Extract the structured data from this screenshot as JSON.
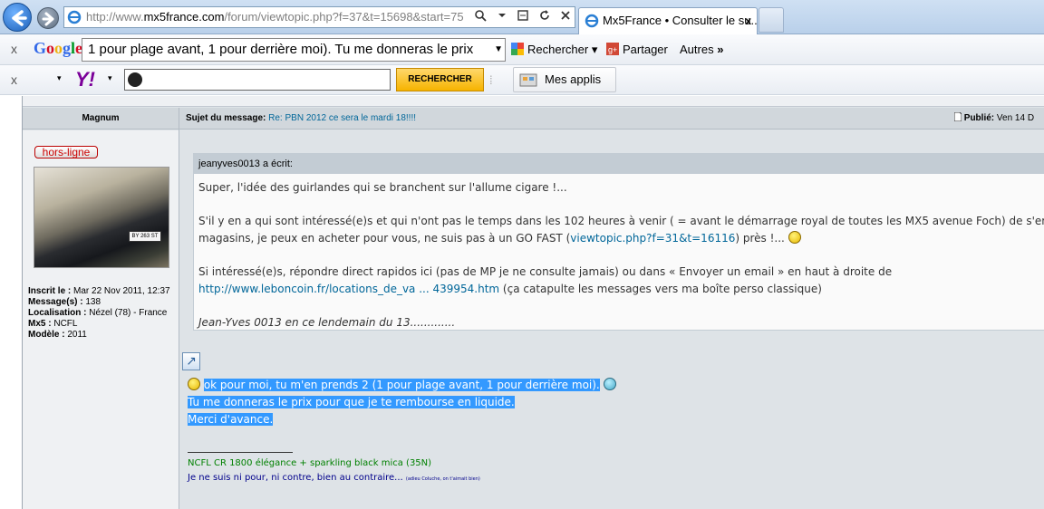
{
  "browser": {
    "address_prefix": "http://www.",
    "address_domain": "mx5france.com",
    "address_path": "/forum/viewtopic.php?f=37&t=15698&start=75",
    "tab_title": "Mx5France • Consulter le su...",
    "tab_close": "x"
  },
  "google_toolbar": {
    "close": "x",
    "logo": "Google",
    "search_value": "1 pour plage avant, 1 pour derrière moi). Tu me donneras le prix",
    "search_label": "Rechercher",
    "share_label": "Partager",
    "more_label": "Autres",
    "more_arrows": "»"
  },
  "yahoo_toolbar": {
    "close": "x",
    "logo": "Y!",
    "search_button": "RECHERCHER",
    "apps_label": "Mes applis"
  },
  "post": {
    "author": "Magnum",
    "subject_label": "Sujet du message:",
    "subject": "Re: PBN 2012 ce sera le mardi 18!!!!",
    "published_label": "Publié:",
    "published_value": "Ven 14 D",
    "status_badge": "hors-ligne",
    "plate": "BY 263 ST",
    "profile": {
      "joined_label": "Inscrit le :",
      "joined_value": "Mar 22 Nov 2011, 12:37",
      "messages_label": "Message(s) :",
      "messages_value": "138",
      "location_label": "Localisation :",
      "location_value": "Nézel (78) - France",
      "mx5_label": "Mx5 :",
      "mx5_value": "NCFL",
      "model_label": "Modèle :",
      "model_value": "2011"
    },
    "quote": {
      "header": "jeanyves0013 a écrit:",
      "line1": "Super, l'idée des guirlandes qui se branchent sur l'allume cigare !...",
      "line2a": "S'il y en a qui sont intéressé(e)s et qui n'ont pas le temps dans les 102 heures à venir ( = avant le démarrage royal de toutes les MX5 avenue Foch) de s'emmerder",
      "line2b_pre": "magasins, je peux en acheter pour vous, ne suis pas à un GO FAST (",
      "line2b_link": "viewtopic.php?f=31&t=16116",
      "line2b_post": ") près !...",
      "line3a": "Si intéressé(e)s, répondre direct rapidos ici (pas de MP je ne consulte jamais) ou dans « Envoyer un email » en haut à droite de",
      "line3b_link": "http://www.leboncoin.fr/locations_de_va ... 439954.htm",
      "line3b_post": " (ça catapulte les messages vers ma boîte perso classique)",
      "line4": "Jean-Yves 0013 en ce lendemain du 13............."
    },
    "message": {
      "line1": "ok pour moi, tu m'en prends 2 (1 pour plage avant, 1 pour derrière moi).",
      "line2": "Tu me donneras le prix pour que je te rembourse en liquide.",
      "line3": "Merci d'avance."
    },
    "signature": {
      "line1": "NCFL CR 1800 élégance + sparkling black mica (35N)",
      "line2": "Je ne suis ni pour, ni contre, bien au contraire...",
      "line2_small": "(adieu Coluche, on t'aimait bien)"
    }
  }
}
